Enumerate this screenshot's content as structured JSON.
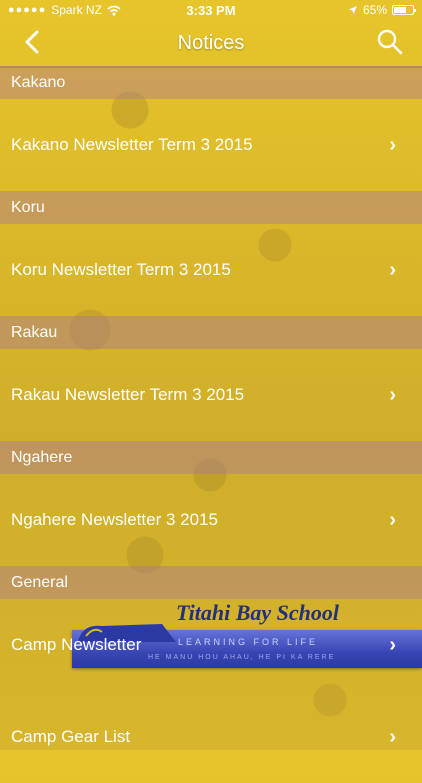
{
  "status_bar": {
    "carrier": "Spark NZ",
    "time": "3:33 PM",
    "battery": "65%",
    "battery_level": 0.65,
    "icons": [
      "signal-dots-icon",
      "wifi-icon",
      "location-arrow-icon",
      "battery-icon"
    ]
  },
  "navbar": {
    "title": "Notices",
    "back_icon": "chevron-left-icon",
    "search_icon": "search-icon"
  },
  "sections": [
    {
      "header": "Kakano",
      "items": [
        {
          "label": "Kakano Newsletter Term 3 2015"
        }
      ]
    },
    {
      "header": "Koru",
      "items": [
        {
          "label": "Koru Newsletter Term 3 2015"
        }
      ]
    },
    {
      "header": "Rakau",
      "items": [
        {
          "label": "Rakau Newsletter Term 3 2015"
        }
      ]
    },
    {
      "header": "Ngahere",
      "items": [
        {
          "label": "Ngahere Newsletter 3 2015"
        }
      ]
    },
    {
      "header": "General",
      "items": [
        {
          "label": "Camp Newsletter"
        },
        {
          "label": "Camp Gear List"
        }
      ]
    }
  ],
  "banner": {
    "title": "Titahi Bay School",
    "tagline": "LEARNING FOR LIFE",
    "motto": "HE MANU HOU AHAU, HE PI KA RERE"
  },
  "colors": {
    "background": "#d9b629",
    "section_header": "#aa7896",
    "banner_blue": "#3846b4",
    "text": "#ffffff"
  }
}
